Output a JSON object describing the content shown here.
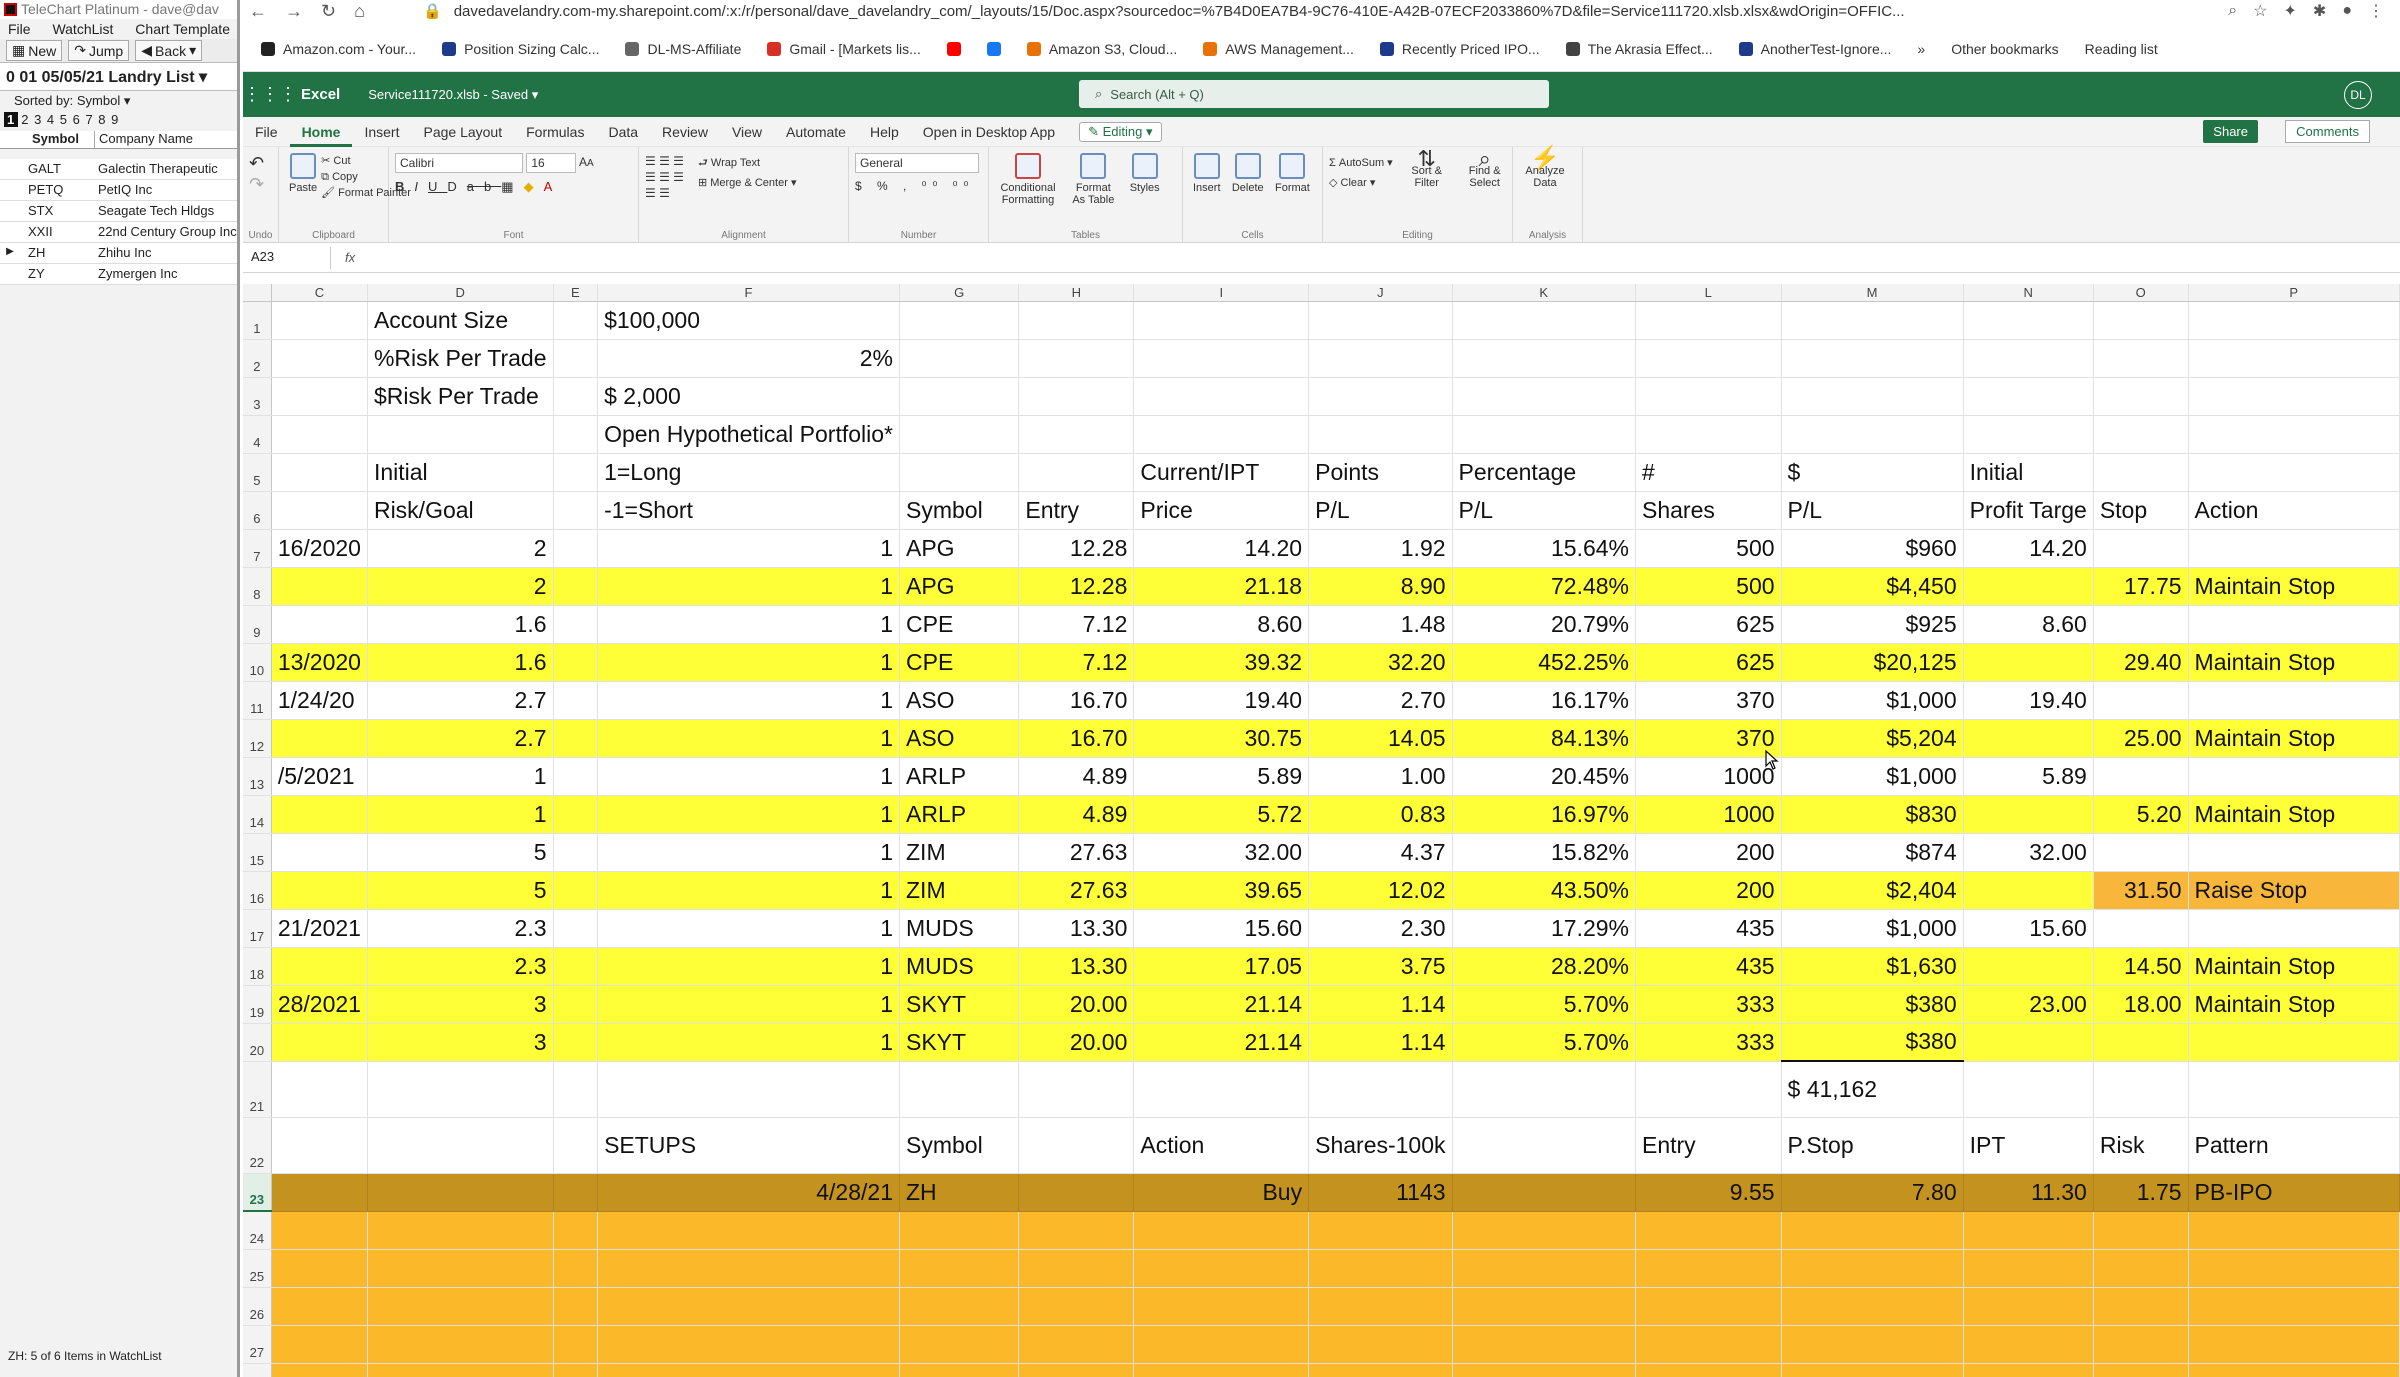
{
  "telechart": {
    "title": "TeleChart Platinum - dave@dav",
    "menu": [
      "File",
      "WatchList",
      "Chart Template"
    ],
    "toolbar": {
      "new": "New",
      "jump": "Jump",
      "back": "Back"
    },
    "list_title": "0 01 05/05/21 Landry List",
    "sorted_by": "Sorted by: Symbol",
    "tabs_numbers": "2 3 4 5 6 7 8 9",
    "tab_active": "1",
    "col_symbol": "Symbol",
    "col_company": "Company Name",
    "rows": [
      {
        "symbol": "GALT",
        "company": "Galectin Therapeutic"
      },
      {
        "symbol": "PETQ",
        "company": "PetIQ Inc"
      },
      {
        "symbol": "STX",
        "company": "Seagate Tech Hldgs"
      },
      {
        "symbol": "XXII",
        "company": "22nd Century Group Inc"
      },
      {
        "symbol": "ZH",
        "company": "Zhihu Inc"
      },
      {
        "symbol": "ZY",
        "company": "Zymergen Inc"
      }
    ],
    "status": "ZH: 5 of 6 Items in WatchList"
  },
  "chrome": {
    "url": "davedavelandry.com-my.sharepoint.com/:x:/r/personal/dave_davelandry_com/_layouts/15/Doc.aspx?sourcedoc=%7B4D0EA7B4-9C76-410E-A42B-07ECF2033860%7D&file=Service111720.xlsb.xlsx&wdOrigin=OFFIC...",
    "bookmarks": [
      {
        "label": "Amazon.com - Your...",
        "color": "#222"
      },
      {
        "label": "Position Sizing Calc...",
        "color": "#1e3a8a"
      },
      {
        "label": "DL-MS-Affiliate",
        "color": "#666"
      },
      {
        "label": "Gmail - [Markets lis...",
        "color": "#d93025"
      },
      {
        "label": "",
        "color": "#ff0000"
      },
      {
        "label": "",
        "color": "#1877f2"
      },
      {
        "label": "Amazon S3, Cloud...",
        "color": "#e8710a"
      },
      {
        "label": "AWS Management...",
        "color": "#e8710a"
      },
      {
        "label": "Recently Priced IPO...",
        "color": "#1e3a8a"
      },
      {
        "label": "The Akrasia Effect...",
        "color": "#444"
      },
      {
        "label": "AnotherTest-Ignore...",
        "color": "#1e3a8a"
      }
    ],
    "other_bookmarks": "Other bookmarks",
    "reading_list": "Reading list",
    "more": "»"
  },
  "excel": {
    "app": "Excel",
    "filename": "Service111720.xlsb - Saved",
    "search": "Search (Alt + Q)",
    "avatar": "DL",
    "tabs": [
      "File",
      "Home",
      "Insert",
      "Page Layout",
      "Formulas",
      "Data",
      "Review",
      "View",
      "Automate",
      "Help",
      "Open in Desktop App"
    ],
    "editing": "Editing",
    "share": "Share",
    "comments": "Comments",
    "ribbon": {
      "undo": "Undo",
      "paste": "Paste",
      "cut": "Cut",
      "copy": "Copy",
      "format_painter": "Format Painter",
      "clipboard": "Clipboard",
      "font_name": "Calibri",
      "font_size": "16",
      "font": "Font",
      "wrap_text": "Wrap Text",
      "merge_center": "Merge & Center",
      "alignment": "Alignment",
      "number_format": "General",
      "number": "Number",
      "conditional_formatting": "Conditional Formatting",
      "format_as_table": "Format As Table",
      "styles": "Styles",
      "tables": "Tables",
      "insert": "Insert",
      "delete": "Delete",
      "format": "Format",
      "cells": "Cells",
      "autosum": "AutoSum",
      "clear": "Clear",
      "sort_filter": "Sort & Filter",
      "find_select": "Find & Select",
      "editing": "Editing",
      "analyze_data": "Analyze Data",
      "analysis": "Analysis"
    },
    "namebox": "A23",
    "fx": "fx"
  },
  "sheet": {
    "columns": [
      "C",
      "D",
      "E",
      "F",
      "G",
      "H",
      "I",
      "J",
      "K",
      "L",
      "M",
      "N",
      "O",
      "P"
    ],
    "rows": [
      {
        "n": "1",
        "cells": [
          "",
          "Account Size",
          "",
          "$100,000",
          "",
          "",
          "",
          "",
          "",
          "",
          "",
          "",
          "",
          ""
        ]
      },
      {
        "n": "2",
        "cells": [
          "",
          "%Risk Per Trade",
          "",
          "2%",
          "",
          "",
          "",
          "",
          "",
          "",
          "",
          "",
          "",
          ""
        ]
      },
      {
        "n": "3",
        "cells": [
          "",
          "$Risk Per Trade",
          "",
          "$      2,000",
          "",
          "",
          "",
          "",
          "",
          "",
          "",
          "",
          "",
          ""
        ]
      },
      {
        "n": "4",
        "cells": [
          "",
          "",
          "",
          "Open Hypothetical Portfolio*",
          "",
          "",
          "",
          "",
          "",
          "",
          "",
          "",
          "",
          ""
        ]
      },
      {
        "n": "5",
        "cells": [
          "",
          "Initial",
          "",
          "1=Long",
          "",
          "",
          "Current/IPT",
          "Points",
          "Percentage",
          "#",
          "$",
          "Initial",
          "",
          ""
        ]
      },
      {
        "n": "6",
        "cells": [
          "",
          "Risk/Goal",
          "",
          "-1=Short",
          "Symbol",
          "Entry",
          "Price",
          "P/L",
          "P/L",
          "Shares",
          "P/L",
          "Profit Targe",
          "Stop",
          "Action"
        ]
      },
      {
        "n": "7",
        "cells": [
          "16/2020",
          "2",
          "",
          "1",
          "APG",
          "12.28",
          "14.20",
          "1.92",
          "15.64%",
          "500",
          "$960",
          "14.20",
          "",
          ""
        ]
      },
      {
        "n": "8",
        "cells": [
          "",
          "2",
          "",
          "1",
          "APG",
          "12.28",
          "21.18",
          "8.90",
          "72.48%",
          "500",
          "$4,450",
          "",
          "17.75",
          "Maintain Stop"
        ]
      },
      {
        "n": "9",
        "cells": [
          "",
          "1.6",
          "",
          "1",
          "CPE",
          "7.12",
          "8.60",
          "1.48",
          "20.79%",
          "625",
          "$925",
          "8.60",
          "",
          ""
        ]
      },
      {
        "n": "10",
        "cells": [
          "13/2020",
          "1.6",
          "",
          "1",
          "CPE",
          "7.12",
          "39.32",
          "32.20",
          "452.25%",
          "625",
          "$20,125",
          "",
          "29.40",
          "Maintain Stop"
        ]
      },
      {
        "n": "11",
        "cells": [
          "1/24/20",
          "2.7",
          "",
          "1",
          "ASO",
          "16.70",
          "19.40",
          "2.70",
          "16.17%",
          "370",
          "$1,000",
          "19.40",
          "",
          ""
        ]
      },
      {
        "n": "12",
        "cells": [
          "",
          "2.7",
          "",
          "1",
          "ASO",
          "16.70",
          "30.75",
          "14.05",
          "84.13%",
          "370",
          "$5,204",
          "",
          "25.00",
          "Maintain Stop"
        ]
      },
      {
        "n": "13",
        "cells": [
          "/5/2021",
          "1",
          "",
          "1",
          "ARLP",
          "4.89",
          "5.89",
          "1.00",
          "20.45%",
          "1000",
          "$1,000",
          "5.89",
          "",
          ""
        ]
      },
      {
        "n": "14",
        "cells": [
          "",
          "1",
          "",
          "1",
          "ARLP",
          "4.89",
          "5.72",
          "0.83",
          "16.97%",
          "1000",
          "$830",
          "",
          "5.20",
          "Maintain Stop"
        ]
      },
      {
        "n": "15",
        "cells": [
          "",
          "5",
          "",
          "1",
          "ZIM",
          "27.63",
          "32.00",
          "4.37",
          "15.82%",
          "200",
          "$874",
          "32.00",
          "",
          ""
        ]
      },
      {
        "n": "16",
        "cells": [
          "",
          "5",
          "",
          "1",
          "ZIM",
          "27.63",
          "39.65",
          "12.02",
          "43.50%",
          "200",
          "$2,404",
          "",
          "31.50",
          "Raise Stop"
        ]
      },
      {
        "n": "17",
        "cells": [
          "21/2021",
          "2.3",
          "",
          "1",
          "MUDS",
          "13.30",
          "15.60",
          "2.30",
          "17.29%",
          "435",
          "$1,000",
          "15.60",
          "",
          ""
        ]
      },
      {
        "n": "18",
        "cells": [
          "",
          "2.3",
          "",
          "1",
          "MUDS",
          "13.30",
          "17.05",
          "3.75",
          "28.20%",
          "435",
          "$1,630",
          "",
          "14.50",
          "Maintain Stop"
        ]
      },
      {
        "n": "19",
        "cells": [
          "28/2021",
          "3",
          "",
          "1",
          "SKYT",
          "20.00",
          "21.14",
          "1.14",
          "5.70%",
          "333",
          "$380",
          "23.00",
          "18.00",
          "Maintain Stop"
        ]
      },
      {
        "n": "20",
        "cells": [
          "",
          "3",
          "",
          "1",
          "SKYT",
          "20.00",
          "21.14",
          "1.14",
          "5.70%",
          "333",
          "$380",
          "",
          "",
          ""
        ]
      },
      {
        "n": "21",
        "cells": [
          "",
          "",
          "",
          "",
          "",
          "",
          "",
          "",
          "",
          "",
          "$           41,162",
          "",
          "",
          ""
        ]
      },
      {
        "n": "22",
        "cells": [
          "",
          "",
          "",
          "SETUPS",
          "Symbol",
          "",
          "Action",
          "Shares-100k",
          "",
          "Entry",
          "P.Stop",
          "IPT",
          "Risk",
          "Pattern"
        ]
      },
      {
        "n": "23",
        "cells": [
          "",
          "",
          "",
          "4/28/21",
          "ZH",
          "",
          "Buy",
          "1143",
          "",
          "9.55",
          "7.80",
          "11.30",
          "1.75",
          "PB-IPO"
        ]
      },
      {
        "n": "24",
        "cells": [
          "",
          "",
          "",
          "",
          "",
          "",
          "",
          "",
          "",
          "",
          "",
          "",
          "",
          ""
        ]
      },
      {
        "n": "25",
        "cells": [
          "",
          "",
          "",
          "",
          "",
          "",
          "",
          "",
          "",
          "",
          "",
          "",
          "",
          ""
        ]
      },
      {
        "n": "26",
        "cells": [
          "",
          "",
          "",
          "",
          "",
          "",
          "",
          "",
          "",
          "",
          "",
          "",
          "",
          ""
        ]
      },
      {
        "n": "27",
        "cells": [
          "",
          "",
          "",
          "",
          "",
          "",
          "",
          "",
          "",
          "",
          "",
          "",
          "",
          ""
        ]
      },
      {
        "n": "28",
        "cells": [
          "",
          "",
          "",
          "",
          "",
          "",
          "",
          "",
          "",
          "",
          "",
          "",
          "",
          ""
        ]
      }
    ]
  }
}
